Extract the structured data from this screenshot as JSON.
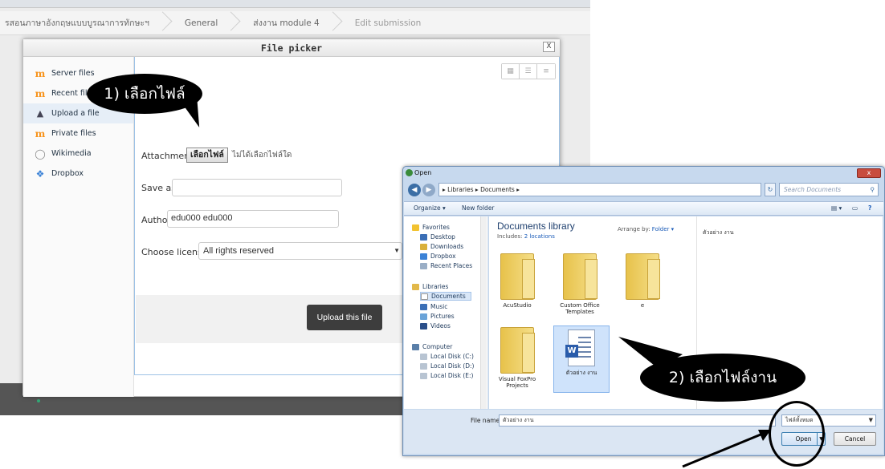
{
  "breadcrumb": {
    "items": [
      "รสอนภาษาอังกฤษแบบบูรณาการทักษะฯ",
      "General",
      "ส่งงาน module 4",
      "Edit submission"
    ]
  },
  "file_picker": {
    "title": "File picker",
    "close": "X",
    "repositories": [
      {
        "label": "Server files",
        "icon": "moodle-icon"
      },
      {
        "label": "Recent files",
        "icon": "moodle-icon"
      },
      {
        "label": "Upload a file",
        "icon": "upload-icon"
      },
      {
        "label": "Private files",
        "icon": "moodle-icon"
      },
      {
        "label": "Wikimedia",
        "icon": "wikimedia-icon"
      },
      {
        "label": "Dropbox",
        "icon": "dropbox-icon"
      }
    ],
    "attachment_label": "Attachment",
    "choose_file_button": "เลือกไฟล์",
    "no_file_text": "ไม่ได้เลือกไฟล์ใด",
    "save_as_label": "Save as",
    "save_as_value": "",
    "author_label": "Author",
    "author_value": "edu000 edu000",
    "license_label": "Choose license",
    "license_value": "All rights reserved",
    "upload_button": "Upload this file"
  },
  "callout_1": "1) เลือกไฟล์",
  "callout_2": "2) เลือกไฟล์งาน",
  "open_dialog": {
    "title": "Open",
    "address": "▸ Libraries ▸ Documents ▸",
    "search_placeholder": "Search Documents",
    "toolbar": {
      "organize": "Organize ▾",
      "new_folder": "New folder"
    },
    "nav": {
      "favorites": "Favorites",
      "favorites_items": [
        "Desktop",
        "Downloads",
        "Dropbox",
        "Recent Places"
      ],
      "libraries": "Libraries",
      "libraries_items": [
        "Documents",
        "Music",
        "Pictures",
        "Videos"
      ],
      "computer": "Computer",
      "computer_items": [
        "Local Disk (C:)",
        "Local Disk (D:)",
        "Local Disk (E:)"
      ]
    },
    "library_title": "Documents library",
    "includes_prefix": "Includes:",
    "includes_link": "2 locations",
    "arrange_by_label": "Arrange by:",
    "arrange_by_value": "Folder ▾",
    "preview_text": "ตัวอย่าง งาน",
    "files": [
      {
        "name": "AcuStudio",
        "type": "folder"
      },
      {
        "name": "Custom Office Templates",
        "type": "folder"
      },
      {
        "name": "e",
        "type": "folder"
      },
      {
        "name": "Visual FoxPro Projects",
        "type": "folder"
      },
      {
        "name": "ตัวอย่าง งาน",
        "type": "word"
      }
    ],
    "file_name_label": "File name:",
    "file_name_value": "ตัวอย่าง งาน",
    "filter_value": "ไฟล์ทั้งหมด",
    "open_button": "Open",
    "cancel_button": "Cancel"
  }
}
